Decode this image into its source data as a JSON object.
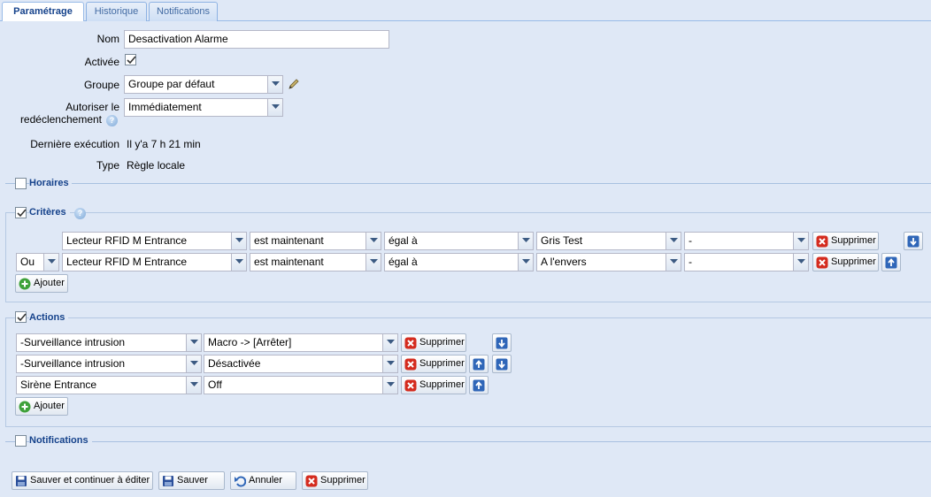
{
  "tabs": [
    {
      "label": "Paramétrage",
      "active": true
    },
    {
      "label": "Historique",
      "active": false
    },
    {
      "label": "Notifications",
      "active": false
    }
  ],
  "form": {
    "nom_label": "Nom",
    "nom_value": "Desactivation Alarme",
    "activee_label": "Activée",
    "activee_checked": true,
    "groupe_label": "Groupe",
    "groupe_value": "Groupe par défaut",
    "redecl_label_1": "Autoriser le",
    "redecl_label_2": "redéclenchement",
    "redecl_value": "Immédiatement",
    "derniere_label": "Dernière exécution",
    "derniere_value": "Il y'a 7 h 21 min",
    "type_label": "Type",
    "type_value": "Règle locale"
  },
  "sections": {
    "horaires": {
      "label": "Horaires",
      "checked": false
    },
    "criteres": {
      "label": "Critères",
      "checked": true
    },
    "actions": {
      "label": "Actions",
      "checked": true
    },
    "notifications": {
      "label": "Notifications",
      "checked": false
    }
  },
  "criteria": [
    {
      "op": "",
      "device": "Lecteur RFID M Entrance",
      "state": "est maintenant",
      "cmp": "égal à",
      "value": "Gris Test",
      "extra": "-",
      "delete": "Supprimer"
    },
    {
      "op": "Ou",
      "device": "Lecteur RFID M Entrance",
      "state": "est maintenant",
      "cmp": "égal à",
      "value": "A l'envers",
      "extra": "-",
      "delete": "Supprimer"
    }
  ],
  "actions": [
    {
      "target": "-Surveillance intrusion",
      "command": "Macro -> [Arrêter]",
      "delete": "Supprimer"
    },
    {
      "target": "-Surveillance intrusion",
      "command": "Désactivée",
      "delete": "Supprimer"
    },
    {
      "target": "Sirène Entrance",
      "command": "Off",
      "delete": "Supprimer"
    }
  ],
  "add_label": "Ajouter",
  "footer": {
    "save_continue": "Sauver et continuer à éditer",
    "save": "Sauver",
    "cancel": "Annuler",
    "delete": "Supprimer"
  },
  "colors": {
    "background": "#dfe8f6",
    "legend_text": "#15428b",
    "border": "#b5b8c8",
    "delete_red": "#d42b1e",
    "add_green": "#3ea13a",
    "arrow_blue": "#2f66b8"
  }
}
